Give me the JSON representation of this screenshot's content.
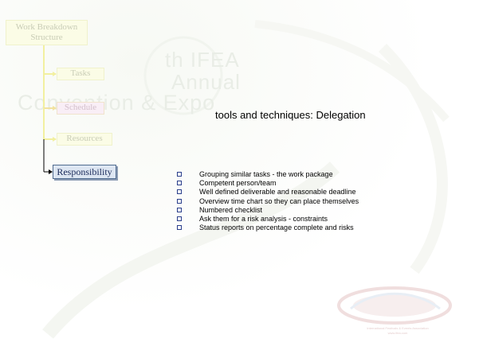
{
  "background": {
    "watermark_line1": "th IFEA",
    "watermark_line2": "Annual",
    "watermark_line3": "Convention & Expo"
  },
  "sidebar": {
    "root": "Work Breakdown Structure",
    "items": [
      {
        "label": "Tasks",
        "active": false
      },
      {
        "label": "Schedule",
        "active": false
      },
      {
        "label": "Resources",
        "active": false
      },
      {
        "label": "Responsibility",
        "active": true
      }
    ]
  },
  "slide": {
    "title": "tools and techniques: Delegation",
    "bullets": [
      "Grouping similar tasks  - the work package",
      "Competent person/team",
      "Well defined deliverable and reasonable deadline",
      "Overview time chart so they can place themselves",
      "Numbered checklist",
      "Ask them for a risk analysis  - constraints",
      "Status reports on percentage complete and risks"
    ]
  },
  "logo": {
    "line1": "International Festivals & Events Association",
    "line2": "www.ifea.com"
  },
  "colors": {
    "active_box": "#dde6f2",
    "active_border": "#4f6b8f",
    "connector": "#f2f0a0",
    "bullet_square": "#2b3f8c"
  }
}
